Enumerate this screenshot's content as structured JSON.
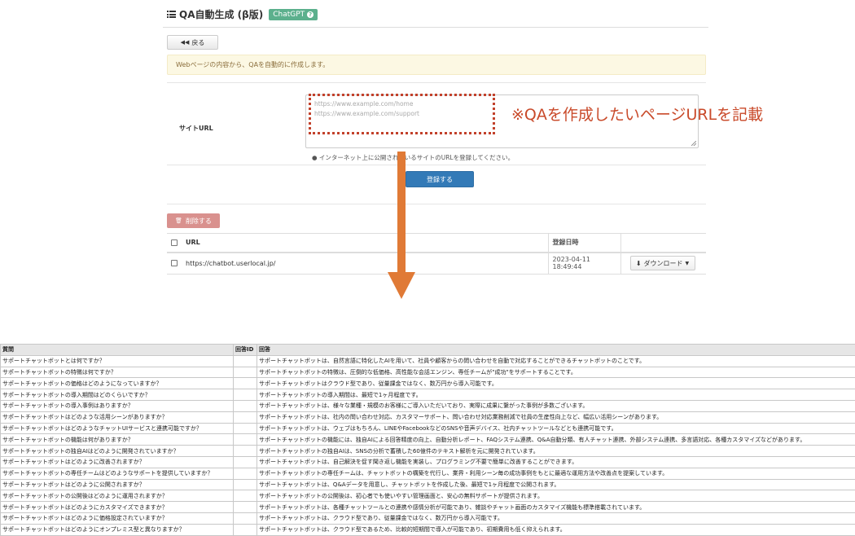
{
  "header": {
    "title": "QA自動生成 (β版)",
    "badge": "ChatGPT",
    "badge_icon": "?"
  },
  "back_button": {
    "icon": "◀◀",
    "label": "戻る"
  },
  "notice": "Webページの内容から、QAを自動的に作成します。",
  "form": {
    "label": "サイトURL",
    "placeholder_lines": [
      "https://www.example.com/home",
      "https://www.example.com/support"
    ],
    "help": "● インターネット上に公開されているサイトのURLを登録してください。",
    "submit_label": "登録する"
  },
  "annotation": "※QAを作成したいページURLを記載",
  "delete_button": {
    "icon": "🗑",
    "label": "削除する"
  },
  "url_table": {
    "headers": {
      "url": "URL",
      "date": "登録日時"
    },
    "rows": [
      {
        "url": "https://chatbot.userlocal.jp/",
        "date": "2023-04-11 18:49:44",
        "action": "ダウンロード"
      }
    ]
  },
  "qa_table": {
    "headers": [
      "質問",
      "回答ID",
      "回答"
    ],
    "rows": [
      [
        "サポートチャットボットとは何ですか？",
        "",
        "サポートチャットボットは、自然言語に特化したAIを用いて、社員や顧客からの問い合わせを自動で対応することができるチャットボットのことです。"
      ],
      [
        "サポートチャットボットの特徴は何ですか？",
        "",
        "サポートチャットボットの特徴は、圧倒的な低価格、高性能な会話エンジン、専任チームが\"成功\"をサポートすることです。"
      ],
      [
        "サポートチャットボットの価格はどのようになっていますか？",
        "",
        "サポートチャットボットはクラウド型であり、従量課金ではなく、数万円から導入可能です。"
      ],
      [
        "サポートチャットボットの導入期間はどのくらいですか？",
        "",
        "サポートチャットボットの導入期間は、最短で1ヶ月程度です。"
      ],
      [
        "サポートチャットボットの導入事例はありますか？",
        "",
        "サポートチャットボットは、様々な業種・規模のお客様にご導入いただいており、実際に成果に繋がった事例が多数ございます。"
      ],
      [
        "サポートチャットボットはどのような活用シーンがありますか？",
        "",
        "サポートチャットボットは、社内の問い合わせ対応、カスタマーサポート、問い合わせ対応業務削減で社員の生産性向上など、幅広い活用シーンがあります。"
      ],
      [
        "サポートチャットボットはどのようなチャットUIサービスと連携可能ですか？",
        "",
        "サポートチャットボットは、ウェブはもちろん、LINEやFacebookなどのSNSや音声デバイス、社内チャットツールなどとも連携可能です。"
      ],
      [
        "サポートチャットボットの機能は何がありますか？",
        "",
        "サポートチャットボットの機能には、独自AIによる回答精度の向上、自動分析レポート、FAQシステム連携、Q&A自動分類、有人チャット連携、外部システム連携、多言語対応、各種カスタマイズなどがあります。"
      ],
      [
        "サポートチャットボットの独自AIはどのように開発されていますか？",
        "",
        "サポートチャットボットの独自AIは、SNSの分析で蓄積した60億件のテキスト解析を元に開発されています。"
      ],
      [
        "サポートチャットボットはどのように改善されますか？",
        "",
        "サポートチャットボットは、自己解決を促す聞き返し機能を実装し、プログラミング不要で簡単に改善することができます。"
      ],
      [
        "サポートチャットボットの専任チームはどのようなサポートを提供していますか？",
        "",
        "サポートチャットボットの専任チームは、チャットボットの構築を代行し、業界・利用シーン毎の成功事例をもとに最適な運用方法や改善点を提案しています。"
      ],
      [
        "サポートチャットボットはどのように公開されますか？",
        "",
        "サポートチャットボットは、Q&Aデータを用意し、チャットボットを作成した後、最短で1ヶ月程度で公開されます。"
      ],
      [
        "サポートチャットボットの公開後はどのように運用されますか？",
        "",
        "サポートチャットボットの公開後は、初心者でも使いやすい管理画面と、安心の無料サポートが提供されます。"
      ],
      [
        "サポートチャットボットはどのようにカスタマイズできますか？",
        "",
        "サポートチャットボットは、各種チャットツールとの連携や感情分析が可能であり、雑談やチャット画面のカスタマイズ機能も標準搭載されています。"
      ],
      [
        "サポートチャットボットはどのように価格設定されていますか？",
        "",
        "サポートチャットボットは、クラウド型であり、従量課金ではなく、数万円から導入可能です。"
      ],
      [
        "サポートチャットボットはどのようにオンプレミス型と異なりますか？",
        "",
        "サポートチャットボットは、クラウド型であるため、比較的短期間で導入が可能であり、初期費用も低く抑えられます。"
      ]
    ]
  }
}
